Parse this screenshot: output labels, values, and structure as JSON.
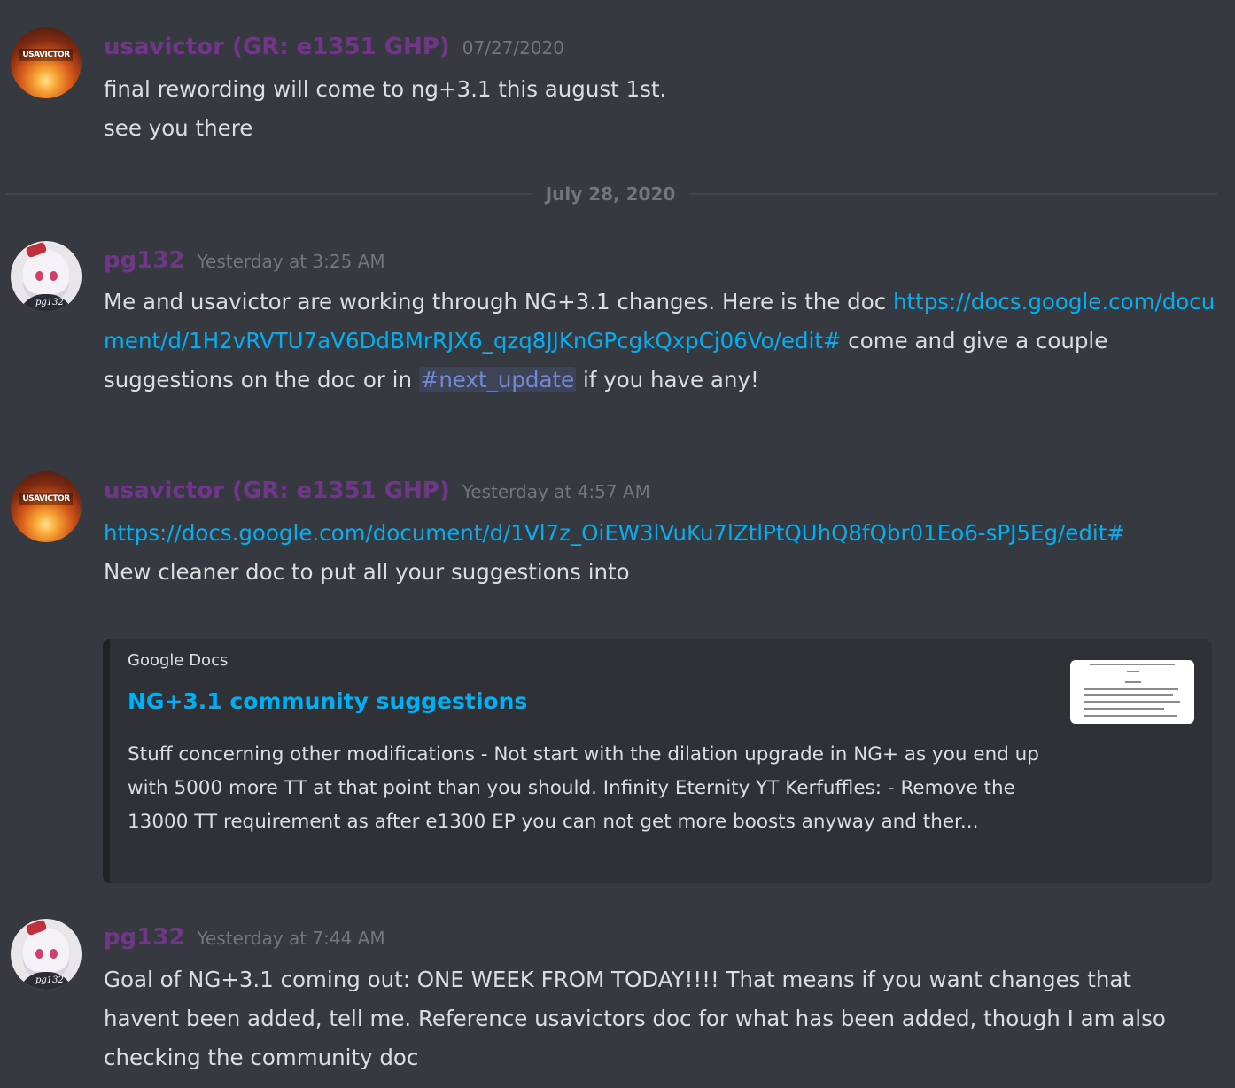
{
  "messages": [
    {
      "username": "usavictor (GR: e1351 GHP)",
      "timestamp": "07/27/2020",
      "avatar_label": "USAVICTOR",
      "lines": [
        "final rewording will come to ng+3.1 this august 1st.",
        "see you there"
      ]
    },
    {
      "username": "pg132",
      "timestamp": "Yesterday at 3:25 AM",
      "avatar_signature": "pg132",
      "text_1": "Me and usavictor are working through NG+3.1 changes. Here is the doc ",
      "link_1": "https://docs.google.com/document/d/1H2vRVTU7aV6DdBMrRJX6_qzq8JJKnGPcgkQxpCj06Vo/edit#",
      "text_2": " come and give a couple suggestions on the doc or in ",
      "channel_mention": "#next_update",
      "text_3": " if you have any!"
    },
    {
      "username": "usavictor (GR: e1351 GHP)",
      "timestamp": "Yesterday at 4:57 AM",
      "avatar_label": "USAVICTOR",
      "link_1": "https://docs.google.com/document/d/1Vl7z_OiEW3lVuKu7lZtlPtQUhQ8fQbr01Eo6-sPJ5Eg/edit#",
      "text_1": "New cleaner doc to put all your suggestions into",
      "embed": {
        "provider": "Google Docs",
        "title": "NG+3.1 community suggestions",
        "description": "Stuff concerning other modifications  - Not start with the dilation upgrade in NG+ as you end up with 5000 more TT at that point than you should. Infinity  Eternity  YT Kerfuffles:  - Remove the 13000 TT requirement as after e1300 EP you can not get more boosts anyway and ther..."
      }
    },
    {
      "username": "pg132",
      "timestamp": "Yesterday at 7:44 AM",
      "avatar_signature": "pg132",
      "text_1": "Goal of NG+3.1 coming out: ONE WEEK FROM TODAY!!!! That means if you want changes that havent been added, tell me. Reference usavictors doc for what has been added, though I am also checking the community doc"
    }
  ],
  "date_divider": "July 28, 2020",
  "colors": {
    "background": "#36393f",
    "username": "#71368a",
    "link": "#00b0f4",
    "mention": "#7289da",
    "timestamp": "#72767d",
    "text": "#dcddde",
    "embed_background": "#2f3136"
  }
}
